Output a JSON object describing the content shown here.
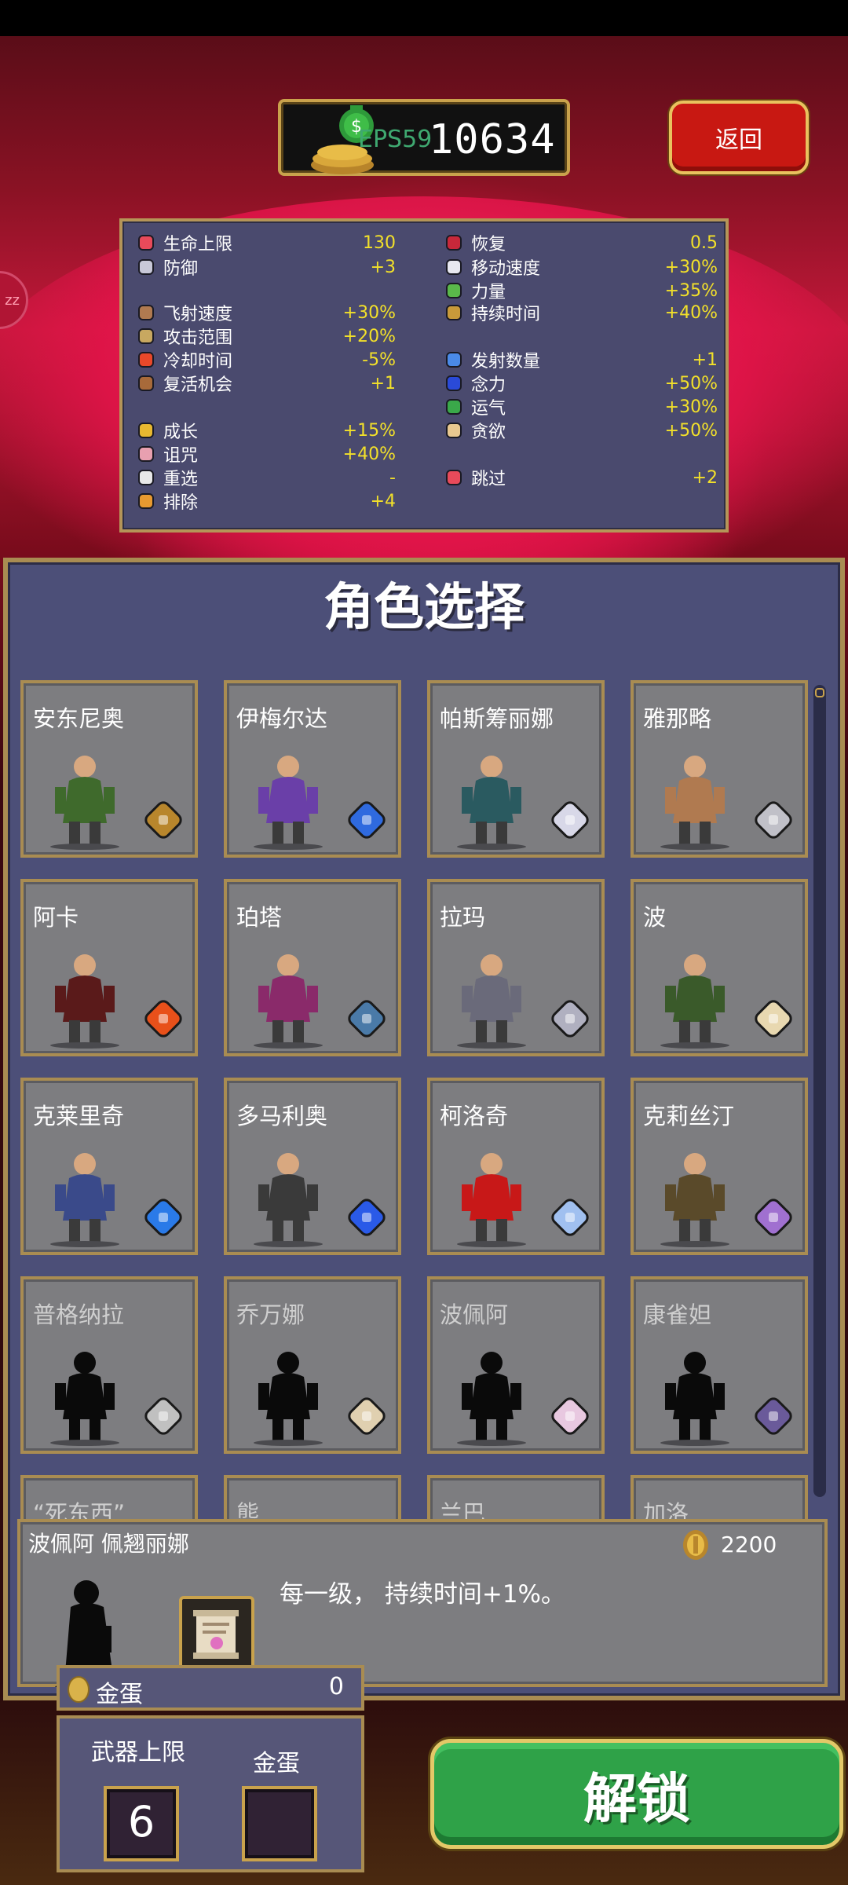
{
  "hud": {
    "fps_label": "EPS59",
    "coins": "10634",
    "back_label": "返回",
    "side_token": "zz"
  },
  "stats": {
    "left": [
      {
        "label": "生命上限",
        "value": "130",
        "icon": "heart-icon"
      },
      {
        "label": "防御",
        "value": "+3",
        "icon": "armor-icon"
      },
      {
        "label": "飞射速度",
        "value": "+30%",
        "icon": "speed-icon"
      },
      {
        "label": "攻击范围",
        "value": "+20%",
        "icon": "area-icon"
      },
      {
        "label": "冷却时间",
        "value": "-5%",
        "icon": "cooldown-icon"
      },
      {
        "label": "复活机会",
        "value": "+1",
        "icon": "revival-icon"
      },
      {
        "label": "成长",
        "value": "+15%",
        "icon": "growth-icon"
      },
      {
        "label": "诅咒",
        "value": "+40%",
        "icon": "curse-icon"
      },
      {
        "label": "重选",
        "value": "-",
        "icon": "reroll-icon"
      },
      {
        "label": "排除",
        "value": "+4",
        "icon": "banish-icon"
      }
    ],
    "right": [
      {
        "label": "恢复",
        "value": "0.5",
        "icon": "recovery-icon"
      },
      {
        "label": "移动速度",
        "value": "+30%",
        "icon": "wing-icon"
      },
      {
        "label": "力量",
        "value": "+35%",
        "icon": "might-icon"
      },
      {
        "label": "持续时间",
        "value": "+40%",
        "icon": "duration-icon"
      },
      {
        "label": "发射数量",
        "value": "+1",
        "icon": "amount-icon"
      },
      {
        "label": "念力",
        "value": "+50%",
        "icon": "magnet-icon"
      },
      {
        "label": "运气",
        "value": "+30%",
        "icon": "clover-icon"
      },
      {
        "label": "贪欲",
        "value": "+50%",
        "icon": "greed-icon"
      },
      {
        "label": "跳过",
        "value": "+2",
        "icon": "skip-icon"
      }
    ]
  },
  "selection": {
    "title": "角色选择",
    "characters": [
      {
        "name": "安东尼奥",
        "locked": false,
        "color": "#3f6a2c",
        "weapon_color": "#b8862c",
        "icon": "whip-icon"
      },
      {
        "name": "伊梅尔达",
        "locked": false,
        "color": "#6a3fa8",
        "weapon_color": "#2f6adf",
        "icon": "magic-wand-icon"
      },
      {
        "name": "帕斯筹丽娜",
        "locked": false,
        "color": "#2a5a60",
        "weapon_color": "#d8d8e8",
        "icon": "runetracer-icon"
      },
      {
        "name": "雅那略",
        "locked": false,
        "color": "#b07a50",
        "weapon_color": "#c0c0c8",
        "icon": "knife-icon"
      },
      {
        "name": "阿卡",
        "locked": false,
        "color": "#5a1a1a",
        "weapon_color": "#e8501a",
        "icon": "fire-wand-icon"
      },
      {
        "name": "珀塔",
        "locked": false,
        "color": "#8a2a6a",
        "weapon_color": "#4a7aa8",
        "icon": "lightning-ring-icon"
      },
      {
        "name": "拉玛",
        "locked": false,
        "color": "#6a6a7a",
        "weapon_color": "#b0b0c0",
        "icon": "axe-icon"
      },
      {
        "name": "波",
        "locked": false,
        "color": "#3a5a2a",
        "weapon_color": "#e8d8b0",
        "icon": "garlic-icon"
      },
      {
        "name": "克莱里奇",
        "locked": false,
        "color": "#3a4a8a",
        "weapon_color": "#2a7ae8",
        "icon": "holy-water-icon"
      },
      {
        "name": "多马利奥",
        "locked": false,
        "color": "#3a3a3a",
        "weapon_color": "#2a5ae8",
        "icon": "king-bible-icon"
      },
      {
        "name": "柯洛奇",
        "locked": false,
        "color": "#c81818",
        "weapon_color": "#a0c0f0",
        "icon": "cross-icon"
      },
      {
        "name": "克莉丝汀",
        "locked": false,
        "color": "#5a4a2a",
        "weapon_color": "#a070d0",
        "icon": "pentagram-icon"
      },
      {
        "name": "普格纳拉",
        "locked": true,
        "color": "#0a0a0a",
        "weapon_color": "#c0c0c0",
        "icon": "phiera-icon"
      },
      {
        "name": "乔万娜",
        "locked": true,
        "color": "#0a0a0a",
        "weapon_color": "#e0d0b0",
        "icon": "peachone-icon"
      },
      {
        "name": "波佩阿",
        "locked": true,
        "color": "#0a0a0a",
        "weapon_color": "#e8c8e0",
        "icon": "song-of-mana-icon"
      },
      {
        "name": "康雀妲",
        "locked": true,
        "color": "#0a0a0a",
        "weapon_color": "#6a5a9a",
        "icon": "bone-icon"
      },
      {
        "name": "“死东西”",
        "locked": true,
        "color": "#0a0a0a",
        "weapon_color": "#888888",
        "icon": "unknown-icon"
      },
      {
        "name": "熊",
        "locked": true,
        "color": "#0a0a0a",
        "weapon_color": "#888888",
        "icon": "unknown-icon"
      },
      {
        "name": "兰巴",
        "locked": true,
        "color": "#0a0a0a",
        "weapon_color": "#888888",
        "icon": "unknown-icon"
      },
      {
        "name": "加洛",
        "locked": true,
        "color": "#0a0a0a",
        "weapon_color": "#888888",
        "icon": "unknown-icon"
      }
    ]
  },
  "detail": {
    "name": "波佩阿  佩翘丽娜",
    "price": "2200",
    "description": "每一级， 持续时间+1%。"
  },
  "eggs": {
    "label": "金蛋",
    "count": "0"
  },
  "slots": {
    "weapon_limit_label": "武器上限",
    "weapon_limit_value": "6",
    "egg_label": "金蛋"
  },
  "unlock_label": "解锁"
}
